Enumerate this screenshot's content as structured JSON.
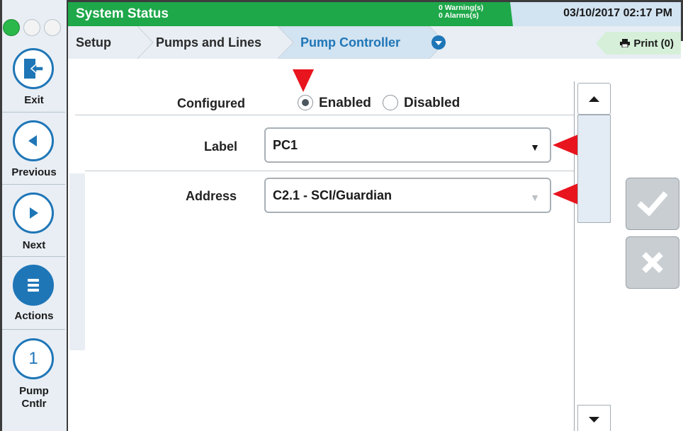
{
  "header": {
    "title": "System Status",
    "warnings": "0 Warning(s)",
    "alarms": "0 Alarms(s)",
    "datetime": "03/10/2017 02:17 PM"
  },
  "tabs": [
    {
      "label": "Setup"
    },
    {
      "label": "Pumps and Lines"
    },
    {
      "label": "Pump Controller"
    }
  ],
  "print_label": "Print (0)",
  "nav": {
    "exit": "Exit",
    "previous": "Previous",
    "next": "Next",
    "actions": "Actions",
    "pump_badge": "1",
    "pump_line1": "Pump",
    "pump_line2": "Cntlr"
  },
  "form": {
    "configured_label": "Configured",
    "enabled_label": "Enabled",
    "disabled_label": "Disabled",
    "configured_value": "Enabled",
    "label_label": "Label",
    "label_value": "PC1",
    "address_label": "Address",
    "address_value": "C2.1 - SCI/Guardian"
  },
  "colors": {
    "status_green": "#1ea84a",
    "accent_blue": "#1f76b7",
    "marker_red": "#e8141e"
  }
}
